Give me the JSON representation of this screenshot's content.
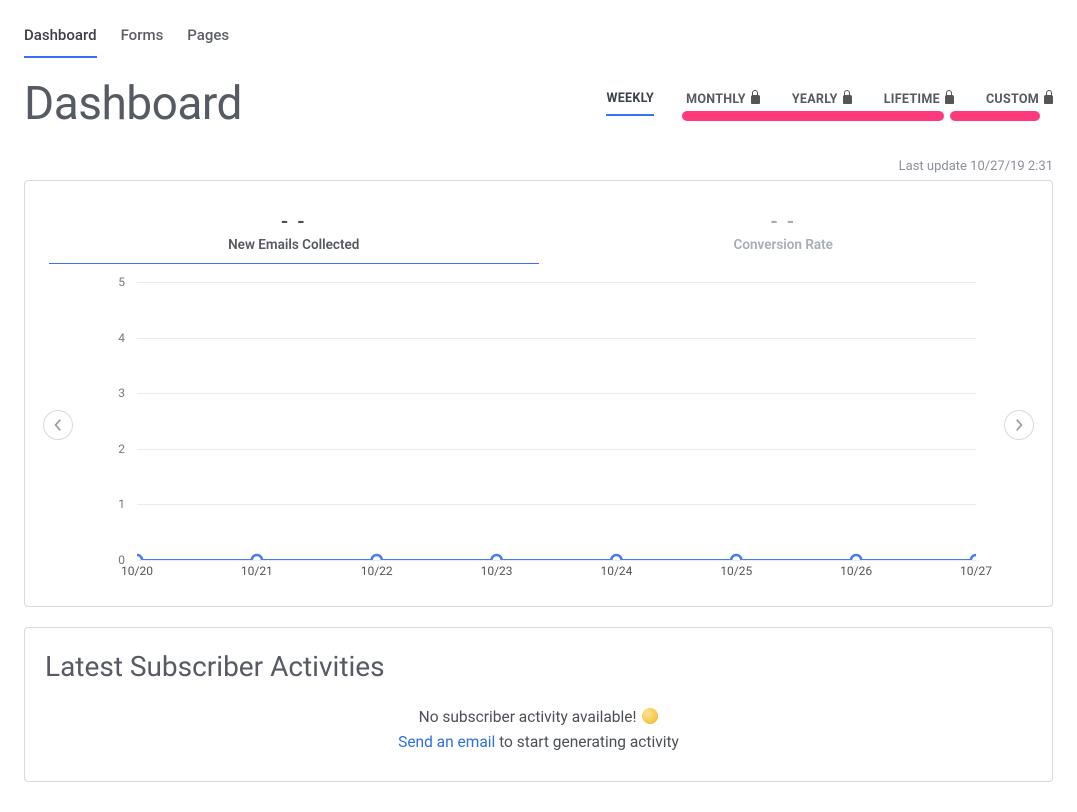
{
  "nav": {
    "items": [
      "Dashboard",
      "Forms",
      "Pages"
    ],
    "active_index": 0
  },
  "page_title": "Dashboard",
  "range": {
    "items": [
      {
        "label": "WEEKLY",
        "locked": false
      },
      {
        "label": "MONTHLY",
        "locked": true
      },
      {
        "label": "YEARLY",
        "locked": true
      },
      {
        "label": "LIFETIME",
        "locked": true
      },
      {
        "label": "CUSTOM",
        "locked": true
      }
    ],
    "active_index": 0
  },
  "last_update": "Last update 10/27/19 2:31",
  "metrics": {
    "tabs": [
      {
        "value": "- -",
        "label": "New Emails Collected"
      },
      {
        "value": "- -",
        "label": "Conversion Rate"
      }
    ],
    "active_index": 0
  },
  "chart_data": {
    "type": "line",
    "title": "",
    "xlabel": "",
    "ylabel": "",
    "ylim": [
      0,
      5
    ],
    "y_ticks": [
      0,
      1,
      2,
      3,
      4,
      5
    ],
    "categories": [
      "10/20",
      "10/21",
      "10/22",
      "10/23",
      "10/24",
      "10/25",
      "10/26",
      "10/27"
    ],
    "series": [
      {
        "name": "New Emails Collected",
        "values": [
          0,
          0,
          0,
          0,
          0,
          0,
          0,
          0
        ]
      }
    ]
  },
  "activities": {
    "title": "Latest Subscriber Activities",
    "empty_message": "No subscriber activity available!",
    "cta_link": "Send an email",
    "cta_rest": " to start generating activity"
  },
  "colors": {
    "accent": "#3a6ff8",
    "annotation": "#ff3a7a",
    "line": "#4a7cf1"
  }
}
